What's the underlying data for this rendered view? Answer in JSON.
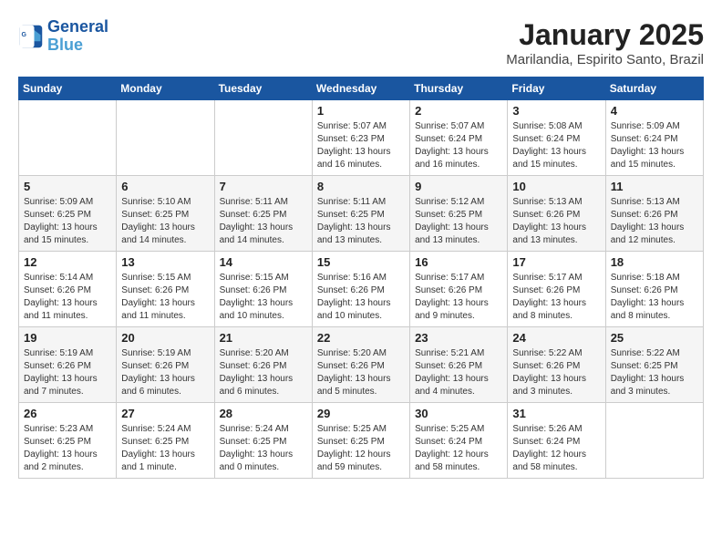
{
  "header": {
    "logo_line1": "General",
    "logo_line2": "Blue",
    "title": "January 2025",
    "subtitle": "Marilandia, Espirito Santo, Brazil"
  },
  "days_of_week": [
    "Sunday",
    "Monday",
    "Tuesday",
    "Wednesday",
    "Thursday",
    "Friday",
    "Saturday"
  ],
  "weeks": [
    [
      {
        "day": "",
        "info": ""
      },
      {
        "day": "",
        "info": ""
      },
      {
        "day": "",
        "info": ""
      },
      {
        "day": "1",
        "info": "Sunrise: 5:07 AM\nSunset: 6:23 PM\nDaylight: 13 hours\nand 16 minutes."
      },
      {
        "day": "2",
        "info": "Sunrise: 5:07 AM\nSunset: 6:24 PM\nDaylight: 13 hours\nand 16 minutes."
      },
      {
        "day": "3",
        "info": "Sunrise: 5:08 AM\nSunset: 6:24 PM\nDaylight: 13 hours\nand 15 minutes."
      },
      {
        "day": "4",
        "info": "Sunrise: 5:09 AM\nSunset: 6:24 PM\nDaylight: 13 hours\nand 15 minutes."
      }
    ],
    [
      {
        "day": "5",
        "info": "Sunrise: 5:09 AM\nSunset: 6:25 PM\nDaylight: 13 hours\nand 15 minutes."
      },
      {
        "day": "6",
        "info": "Sunrise: 5:10 AM\nSunset: 6:25 PM\nDaylight: 13 hours\nand 14 minutes."
      },
      {
        "day": "7",
        "info": "Sunrise: 5:11 AM\nSunset: 6:25 PM\nDaylight: 13 hours\nand 14 minutes."
      },
      {
        "day": "8",
        "info": "Sunrise: 5:11 AM\nSunset: 6:25 PM\nDaylight: 13 hours\nand 13 minutes."
      },
      {
        "day": "9",
        "info": "Sunrise: 5:12 AM\nSunset: 6:25 PM\nDaylight: 13 hours\nand 13 minutes."
      },
      {
        "day": "10",
        "info": "Sunrise: 5:13 AM\nSunset: 6:26 PM\nDaylight: 13 hours\nand 13 minutes."
      },
      {
        "day": "11",
        "info": "Sunrise: 5:13 AM\nSunset: 6:26 PM\nDaylight: 13 hours\nand 12 minutes."
      }
    ],
    [
      {
        "day": "12",
        "info": "Sunrise: 5:14 AM\nSunset: 6:26 PM\nDaylight: 13 hours\nand 11 minutes."
      },
      {
        "day": "13",
        "info": "Sunrise: 5:15 AM\nSunset: 6:26 PM\nDaylight: 13 hours\nand 11 minutes."
      },
      {
        "day": "14",
        "info": "Sunrise: 5:15 AM\nSunset: 6:26 PM\nDaylight: 13 hours\nand 10 minutes."
      },
      {
        "day": "15",
        "info": "Sunrise: 5:16 AM\nSunset: 6:26 PM\nDaylight: 13 hours\nand 10 minutes."
      },
      {
        "day": "16",
        "info": "Sunrise: 5:17 AM\nSunset: 6:26 PM\nDaylight: 13 hours\nand 9 minutes."
      },
      {
        "day": "17",
        "info": "Sunrise: 5:17 AM\nSunset: 6:26 PM\nDaylight: 13 hours\nand 8 minutes."
      },
      {
        "day": "18",
        "info": "Sunrise: 5:18 AM\nSunset: 6:26 PM\nDaylight: 13 hours\nand 8 minutes."
      }
    ],
    [
      {
        "day": "19",
        "info": "Sunrise: 5:19 AM\nSunset: 6:26 PM\nDaylight: 13 hours\nand 7 minutes."
      },
      {
        "day": "20",
        "info": "Sunrise: 5:19 AM\nSunset: 6:26 PM\nDaylight: 13 hours\nand 6 minutes."
      },
      {
        "day": "21",
        "info": "Sunrise: 5:20 AM\nSunset: 6:26 PM\nDaylight: 13 hours\nand 6 minutes."
      },
      {
        "day": "22",
        "info": "Sunrise: 5:20 AM\nSunset: 6:26 PM\nDaylight: 13 hours\nand 5 minutes."
      },
      {
        "day": "23",
        "info": "Sunrise: 5:21 AM\nSunset: 6:26 PM\nDaylight: 13 hours\nand 4 minutes."
      },
      {
        "day": "24",
        "info": "Sunrise: 5:22 AM\nSunset: 6:26 PM\nDaylight: 13 hours\nand 3 minutes."
      },
      {
        "day": "25",
        "info": "Sunrise: 5:22 AM\nSunset: 6:25 PM\nDaylight: 13 hours\nand 3 minutes."
      }
    ],
    [
      {
        "day": "26",
        "info": "Sunrise: 5:23 AM\nSunset: 6:25 PM\nDaylight: 13 hours\nand 2 minutes."
      },
      {
        "day": "27",
        "info": "Sunrise: 5:24 AM\nSunset: 6:25 PM\nDaylight: 13 hours\nand 1 minute."
      },
      {
        "day": "28",
        "info": "Sunrise: 5:24 AM\nSunset: 6:25 PM\nDaylight: 13 hours\nand 0 minutes."
      },
      {
        "day": "29",
        "info": "Sunrise: 5:25 AM\nSunset: 6:25 PM\nDaylight: 12 hours\nand 59 minutes."
      },
      {
        "day": "30",
        "info": "Sunrise: 5:25 AM\nSunset: 6:24 PM\nDaylight: 12 hours\nand 58 minutes."
      },
      {
        "day": "31",
        "info": "Sunrise: 5:26 AM\nSunset: 6:24 PM\nDaylight: 12 hours\nand 58 minutes."
      },
      {
        "day": "",
        "info": ""
      }
    ]
  ]
}
